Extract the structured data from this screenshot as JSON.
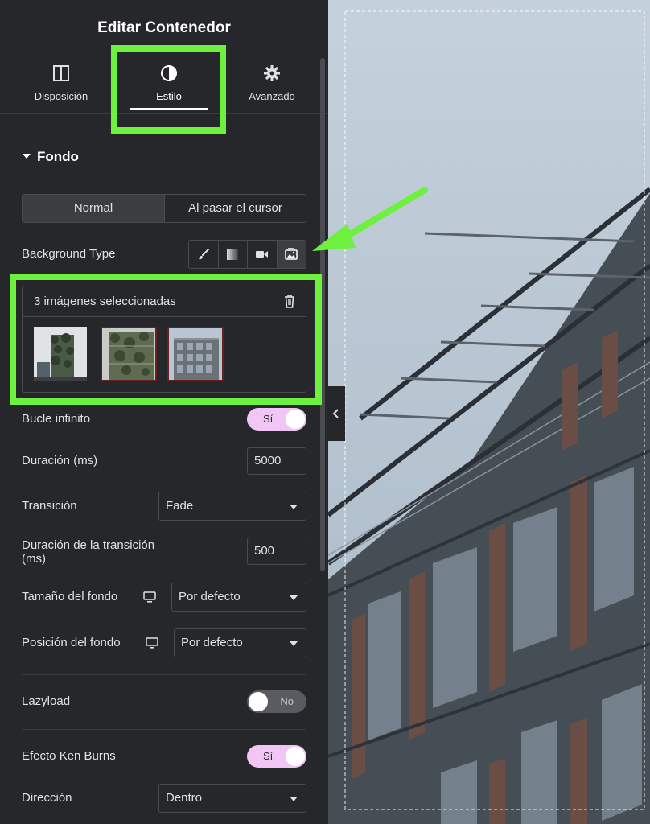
{
  "panel": {
    "title": "Editar Contenedor",
    "tabs": [
      {
        "label": "Disposición",
        "icon": "columns-icon"
      },
      {
        "label": "Estilo",
        "icon": "contrast-icon",
        "active": true
      },
      {
        "label": "Avanzado",
        "icon": "gear-icon"
      }
    ],
    "section": "Fondo",
    "state_tabs": [
      "Normal",
      "Al pasar el cursor"
    ],
    "background_type": {
      "label": "Background Type",
      "options": [
        "brush-icon",
        "gradient-icon",
        "video-icon",
        "slideshow-icon"
      ],
      "active_index": 3
    },
    "gallery": {
      "title": "3 imágenes seleccionadas",
      "images": [
        "vertical-garden-building",
        "green-facade-closeup",
        "office-building"
      ]
    },
    "fields": {
      "loop": {
        "label": "Bucle infinito",
        "value": "Sí"
      },
      "duration": {
        "label": "Duración (ms)",
        "value": "5000"
      },
      "transition": {
        "label": "Transición",
        "value": "Fade"
      },
      "transition_duration": {
        "label_line1": "Duración de la transición",
        "label_line2": "(ms)",
        "value": "500"
      },
      "bg_size": {
        "label": "Tamaño del fondo",
        "value": "Por defecto"
      },
      "bg_position": {
        "label": "Posición del fondo",
        "value": "Por defecto"
      },
      "lazyload": {
        "label": "Lazyload",
        "value": "No"
      },
      "ken_burns": {
        "label": "Efecto Ken Burns",
        "value": "Sí"
      },
      "direction": {
        "label": "Dirección",
        "value": "Dentro"
      }
    }
  },
  "colors": {
    "highlight": "#6ef03e",
    "panel_bg": "#26272b",
    "toggle_on": "#f1c6f5"
  }
}
